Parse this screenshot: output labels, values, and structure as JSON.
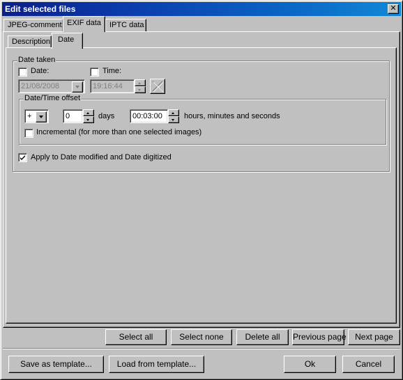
{
  "window": {
    "title": "Edit selected files",
    "close_label": "✕"
  },
  "tabs": [
    {
      "label": "JPEG-comment",
      "active": false
    },
    {
      "label": "EXIF data",
      "active": true
    },
    {
      "label": "IPTC data",
      "active": false
    }
  ],
  "subtabs": [
    {
      "label": "Description",
      "active": false
    },
    {
      "label": "Date",
      "active": true
    }
  ],
  "date_taken": {
    "group_label": "Date taken",
    "date_checkbox": {
      "label": "Date:",
      "checked": false
    },
    "time_checkbox": {
      "label": "Time:",
      "checked": false
    },
    "date_value": "21/08/2008",
    "time_value": "19:16:44",
    "clear_icon": "x-icon"
  },
  "offset": {
    "group_label": "Date/Time offset",
    "sign_value": "+",
    "days_value": "0",
    "days_label": "days",
    "time_value": "00:03:00",
    "time_label": "hours, minutes and seconds",
    "incremental": {
      "label": "Incremental (for more than one selected images)",
      "checked": false
    }
  },
  "apply_checkbox": {
    "label": "Apply to Date modified and Date digitized",
    "checked": true
  },
  "page_buttons": {
    "select_all": "Select all",
    "select_none": "Select none",
    "delete_all": "Delete all",
    "previous_page": "Previous page",
    "next_page": "Next page"
  },
  "footer_buttons": {
    "save_template": "Save as template...",
    "load_template": "Load from template...",
    "ok": "Ok",
    "cancel": "Cancel"
  }
}
